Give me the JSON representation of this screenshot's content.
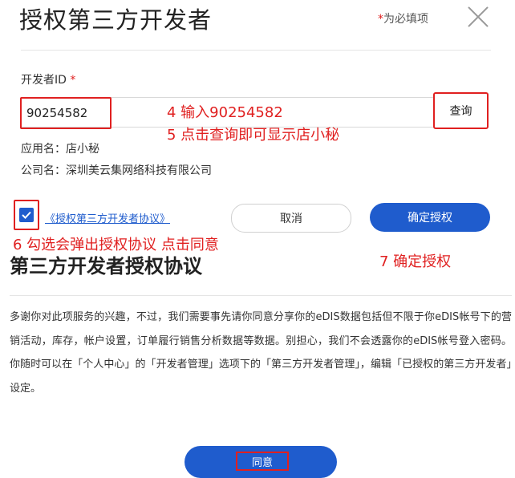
{
  "dialog": {
    "title": "授权第三方开发者",
    "required_star": "*",
    "required_note": "为必填项"
  },
  "form": {
    "developer_id_label": "开发者ID",
    "developer_id_star": "*",
    "developer_id_value": "90254582",
    "query_button": "查询"
  },
  "result": {
    "app_name": "应用名：店小秘",
    "company_name": "公司名：深圳美云集网络科技有限公司"
  },
  "agreement": {
    "checked": true,
    "link_text": "《授权第三方开发者协议》",
    "title": "第三方开发者授权协议",
    "body": "多谢你对此项服务的兴趣，不过，我们需要事先请你同意分享你的eDIS数据包括但不限于你eDIS帐号下的营销活动，库存，帐户设置，订单履行销售分析数据等数据。别担心，我们不会透露你的eDIS帐号登入密码。你随时可以在「个人中心」的「开发者管理」选项下的「第三方开发者管理」，编辑「已授权的第三方开发者」设定。",
    "agree_button": "同意"
  },
  "actions": {
    "cancel_button": "取消",
    "confirm_button": "确定授权"
  },
  "annotations": {
    "step4": "4 输入90254582",
    "step5": "5 点击查询即可显示店小秘",
    "step6": "6 勾选会弹出授权协议 点击同意",
    "step7": "7 确定授权"
  },
  "colors": {
    "primary": "#1f5ccd",
    "annotation_red": "#e02020"
  },
  "icons": {
    "close": "close-icon",
    "checkmark": "checkmark-icon"
  }
}
